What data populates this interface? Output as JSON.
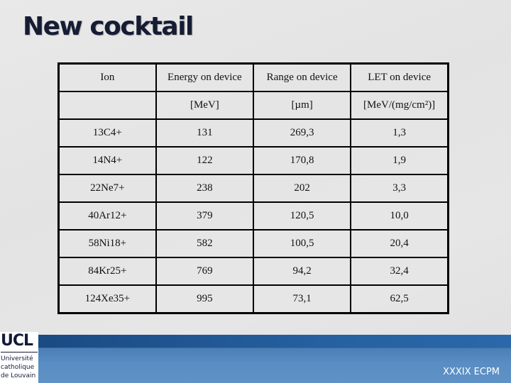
{
  "slide": {
    "title": "New cocktail",
    "footer": "XXXIX ECPM",
    "logo": {
      "acronym": "UCL",
      "lines": [
        "Université",
        "catholique",
        "de Louvain"
      ]
    }
  },
  "table": {
    "headers": [
      "Ion",
      "Energy on device",
      "Range on device",
      "LET on device"
    ],
    "units": [
      "",
      "[MeV]",
      "[µm]",
      "[MeV/(mg/cm²)]"
    ],
    "rows": [
      [
        "13C4+",
        "131",
        "269,3",
        "1,3"
      ],
      [
        "14N4+",
        "122",
        "170,8",
        "1,9"
      ],
      [
        "22Ne7+",
        "238",
        "202",
        "3,3"
      ],
      [
        "40Ar12+",
        "379",
        "120,5",
        "10,0"
      ],
      [
        "58Ni18+",
        "582",
        "100,5",
        "20,4"
      ],
      [
        "84Kr25+",
        "769",
        "94,2",
        "32,4"
      ],
      [
        "124Xe35+",
        "995",
        "73,1",
        "62,5"
      ]
    ]
  }
}
